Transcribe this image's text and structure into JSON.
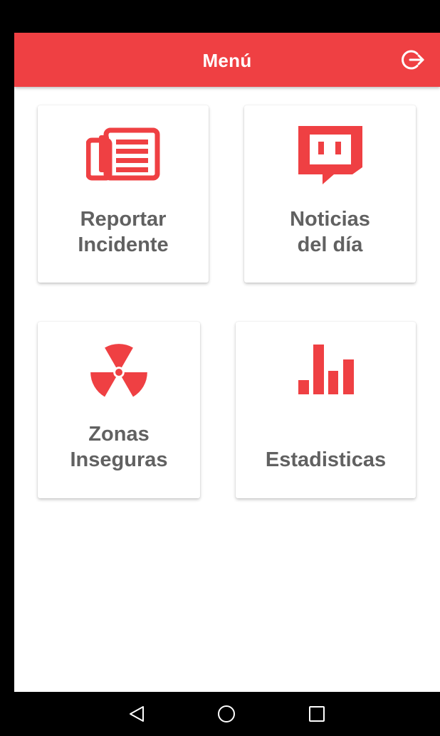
{
  "header": {
    "title": "Menú",
    "logout_icon": "logout-icon",
    "background_color": "#ef4043"
  },
  "cards": [
    {
      "id": "report",
      "label_lines": [
        "Reportar",
        "Incidente"
      ],
      "icon": "newspaper-icon"
    },
    {
      "id": "news",
      "label_lines": [
        "Noticias",
        "del día"
      ],
      "icon": "chat-bubble-icon"
    },
    {
      "id": "zones",
      "label_lines": [
        "Zonas",
        "Inseguras"
      ],
      "icon": "radiation-icon"
    },
    {
      "id": "stats",
      "label_lines": [
        "Estadisticas"
      ],
      "icon": "bar-chart-icon"
    }
  ],
  "theme": {
    "accent": "#ef4043",
    "label_color": "#616161"
  },
  "nav_bar": {
    "buttons": [
      "back-icon",
      "home-icon",
      "recents-icon"
    ]
  }
}
